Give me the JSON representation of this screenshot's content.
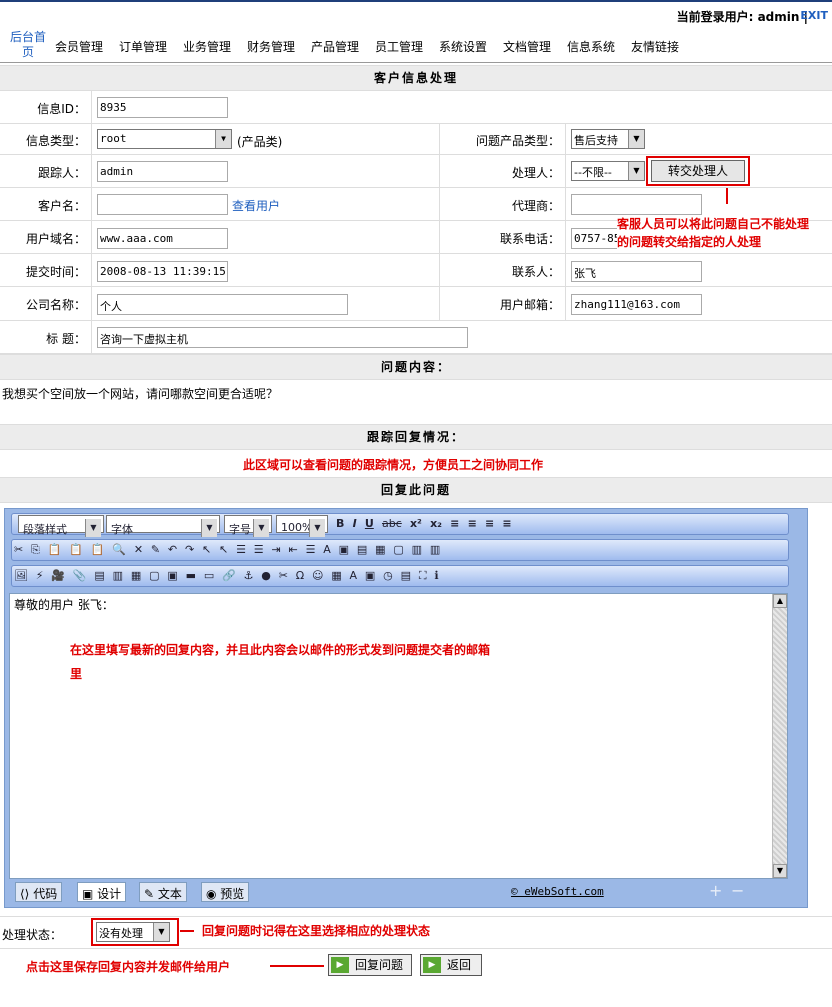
{
  "header": {
    "user_label": "当前登录用户: admin  |",
    "exit_label": "EXIT"
  },
  "nav": {
    "home": "后台首页",
    "items": [
      "会员管理",
      "订单管理",
      "业务管理",
      "财务管理",
      "产品管理",
      "员工管理",
      "系统设置",
      "文档管理",
      "信息系统",
      "友情链接"
    ]
  },
  "form": {
    "title": "客户信息处理",
    "info_id": {
      "label": "信息ID：",
      "value": "8935"
    },
    "info_type": {
      "label": "信息类型：",
      "value": "root",
      "suffix": "(产品类)"
    },
    "problem_product_type": {
      "label": "问题产品类型：",
      "value": "售后支持"
    },
    "tracker": {
      "label": "跟踪人：",
      "value": "admin"
    },
    "handler": {
      "label": "处理人：",
      "value": "--不限--",
      "button": "转交处理人"
    },
    "customer_name": {
      "label": "客户名：",
      "value": "",
      "link": "查看用户"
    },
    "agent": {
      "label": "代理商：",
      "value": ""
    },
    "user_domain": {
      "label": "用户域名：",
      "value": "www.aaa.com"
    },
    "phone": {
      "label": "联系电话：",
      "value": "0757-85"
    },
    "submit_time": {
      "label": "提交时间：",
      "value": "2008-08-13 11:39:15"
    },
    "contact": {
      "label": "联系人：",
      "value": "张飞"
    },
    "company": {
      "label": "公司名称：",
      "value": "个人"
    },
    "email": {
      "label": "用户邮箱：",
      "value": "zhang111@163.com"
    },
    "subject": {
      "label": "标  题：",
      "value": "咨询一下虚拟主机"
    }
  },
  "annotations": {
    "transfer_note": "客服人员可以将此问题自己不能处理 的问题转交给指定的人处理",
    "tracking_note": "此区域可以查看问题的跟踪情况，方便员工之间协同工作",
    "editor_note": "在这里填写最新的回复内容，并且此内容会以邮件的形式发到问题提交者的邮箱里",
    "status_note": "回复问题时记得在这里选择相应的处理状态",
    "save_note": "点击这里保存回复内容并发邮件给用户"
  },
  "problem": {
    "title": "问题内容：",
    "content": "我想买个空间放一个网站，请问哪款空间更合适呢？"
  },
  "tracking": {
    "title": "跟踪回复情况："
  },
  "reply": {
    "title": "回复此问题",
    "toolbar": {
      "paragraph": "段落样式",
      "font": "字体",
      "size": "字号",
      "zoom": "100%"
    },
    "content": "尊敬的用户 张飞：",
    "modes": [
      "代码",
      "设计",
      "文本",
      "预览"
    ],
    "brand": "© eWebSoft.com"
  },
  "status": {
    "label": "处理状态：",
    "value": "没有处理"
  },
  "actions": {
    "reply": "回复问题",
    "back": "返回"
  },
  "colors": {
    "annotation": "#e00000",
    "link": "#1f5fbf",
    "editor_bg": "#9bb8e6"
  }
}
